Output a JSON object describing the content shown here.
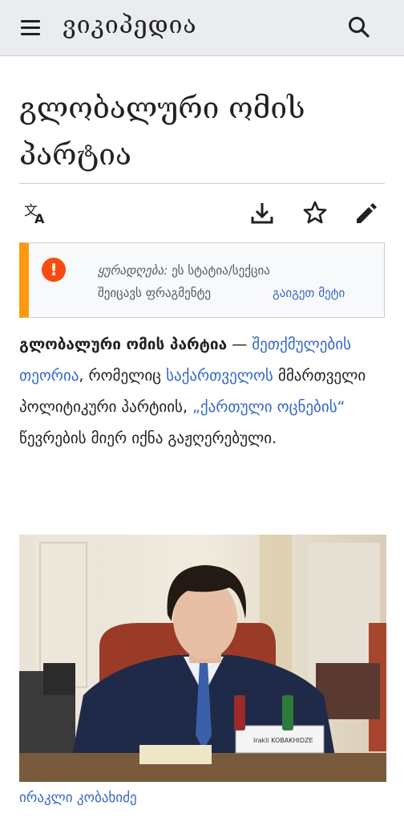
{
  "header": {
    "wordmark": "ვიკიპედია",
    "menu_icon": "hamburger-menu-icon",
    "search_icon": "search-icon",
    "background": "#eaecf0"
  },
  "article": {
    "title": "გლობალური ომის პარტია",
    "actions": {
      "language_icon": "translate-icon",
      "download_icon": "download-icon",
      "watch_icon": "star-icon",
      "edit_icon": "pencil-icon"
    },
    "notice": {
      "label": "ყურადღება",
      "message": "ეს სტატია/სექცია შეიცავს ფრაგმენტე",
      "message_line1_rest": "ეს სტატია/სექცია",
      "message_line2": "შეიცავს ფრაგმენტე",
      "more_link": "გაიგეთ მეტი",
      "icon": "exclamation-icon",
      "accent_color": "#fc9910"
    },
    "intro": {
      "bold_term": "გლობალური ომის პარტია",
      "dash": " — ",
      "link_conspiracy": "შეთქმულების თეორია",
      "text_1": ", რომელიც ",
      "link_georgia": "საქართველოს",
      "text_2": " მმართველი პოლიტიკური პარტიის, ",
      "link_party": "„ქართული ოცნების“",
      "text_3": " წევრების მიერ იქნა გაჟღერებული."
    },
    "image": {
      "description_hidden": "",
      "caption_link": "ირაკლი კობახიძე",
      "nameplate": "Irakli KOBAKHIDZE"
    },
    "link_color": "#3366cc"
  }
}
